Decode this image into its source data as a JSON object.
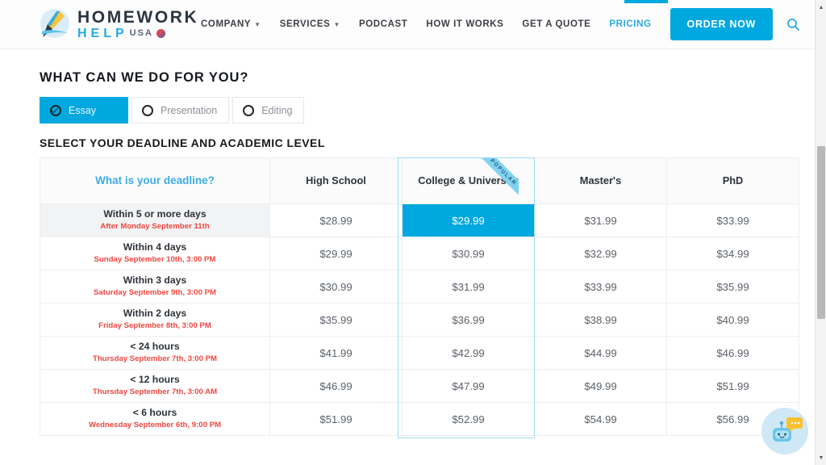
{
  "brand": {
    "logo_top": "HOMEWORK",
    "logo_bottom": "HELP",
    "logo_suffix": "USA",
    "accent_color": "#00a8e0",
    "red_color": "#f0453f",
    "heading_color": "#16191d"
  },
  "nav": {
    "items": [
      {
        "label": "COMPANY",
        "has_caret": true,
        "active": false
      },
      {
        "label": "SERVICES",
        "has_caret": true,
        "active": false
      },
      {
        "label": "PODCAST",
        "has_caret": false,
        "active": false
      },
      {
        "label": "HOW IT WORKS",
        "has_caret": false,
        "active": false
      },
      {
        "label": "GET A QUOTE",
        "has_caret": false,
        "active": false
      },
      {
        "label": "PRICING",
        "has_caret": false,
        "active": true
      }
    ],
    "order_button": "ORDER NOW",
    "search_icon": "search-icon"
  },
  "main": {
    "title": "WHAT CAN WE DO FOR YOU?",
    "subtitle": "SELECT YOUR DEADLINE AND ACADEMIC LEVEL",
    "service_tabs": [
      {
        "label": "Essay",
        "selected": true
      },
      {
        "label": "Presentation",
        "selected": false
      },
      {
        "label": "Editing",
        "selected": false
      }
    ]
  },
  "chart_data": {
    "type": "table",
    "title": "SELECT YOUR DEADLINE AND ACADEMIC LEVEL",
    "deadline_header": "What is your deadline?",
    "popular_badge": "POPULAR",
    "popular_column_index": 1,
    "selected_cell": {
      "row": 0,
      "column": 1,
      "value": "$29.99"
    },
    "selected_row_index": 0,
    "categories": [
      "High School",
      "College & University",
      "Master's",
      "PhD"
    ],
    "rows": [
      {
        "deadline": "Within 5 or more days",
        "date": "After Monday September 11th",
        "prices": [
          "$28.99",
          "$29.99",
          "$31.99",
          "$33.99"
        ]
      },
      {
        "deadline": "Within 4 days",
        "date": "Sunday September 10th, 3:00 PM",
        "prices": [
          "$29.99",
          "$30.99",
          "$32.99",
          "$34.99"
        ]
      },
      {
        "deadline": "Within 3 days",
        "date": "Saturday September 9th, 3:00 PM",
        "prices": [
          "$30.99",
          "$31.99",
          "$33.99",
          "$35.99"
        ]
      },
      {
        "deadline": "Within 2 days",
        "date": "Friday September 8th, 3:00 PM",
        "prices": [
          "$35.99",
          "$36.99",
          "$38.99",
          "$40.99"
        ]
      },
      {
        "deadline": "< 24 hours",
        "date": "Thursday September 7th, 3:00 PM",
        "prices": [
          "$41.99",
          "$42.99",
          "$44.99",
          "$46.99"
        ]
      },
      {
        "deadline": "< 12 hours",
        "date": "Thursday September 7th, 3:00 AM",
        "prices": [
          "$46.99",
          "$47.99",
          "$49.99",
          "$51.99"
        ]
      },
      {
        "deadline": "< 6 hours",
        "date": "Wednesday September 6th, 9:00 PM",
        "prices": [
          "$51.99",
          "$52.99",
          "$54.99",
          "$56.99"
        ]
      }
    ]
  },
  "chat": {
    "icon": "robot-chat-icon"
  },
  "scrollbar": {
    "up_arrow": "▲",
    "down_arrow": "▼"
  }
}
